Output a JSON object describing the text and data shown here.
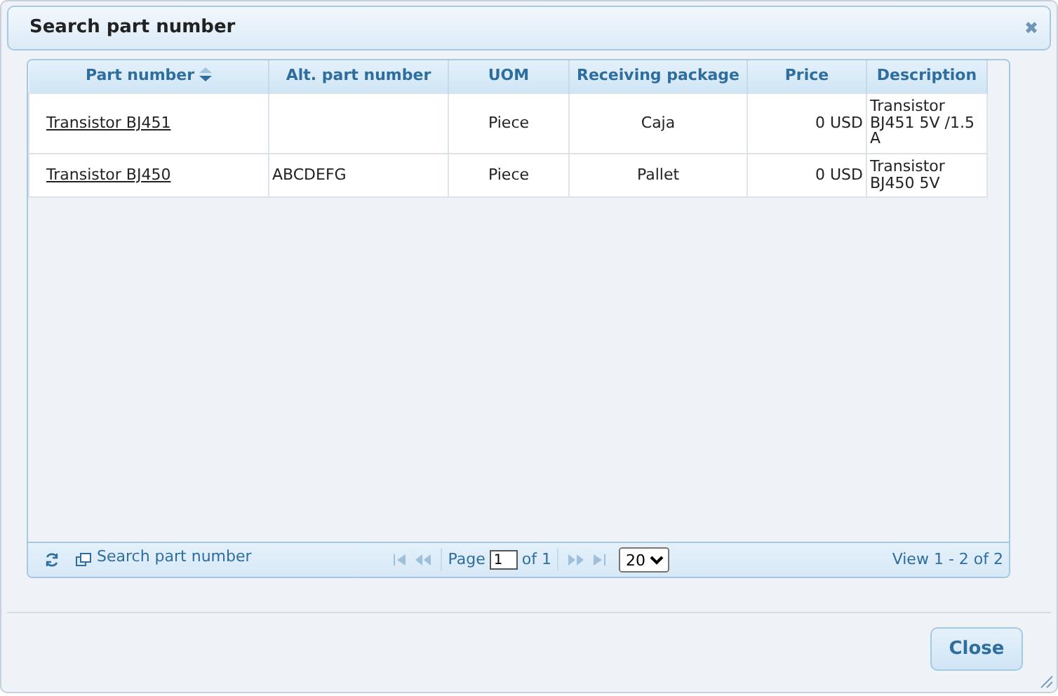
{
  "dialog": {
    "title": "Search part number",
    "close_symbol": "✖"
  },
  "table": {
    "columns": [
      {
        "label": "Part number",
        "sorted": true
      },
      {
        "label": "Alt. part number",
        "sorted": false
      },
      {
        "label": "UOM",
        "sorted": false
      },
      {
        "label": "Receiving package",
        "sorted": false
      },
      {
        "label": "Price",
        "sorted": false
      },
      {
        "label": "Description",
        "sorted": false
      }
    ],
    "rows": [
      {
        "part_number": "Transistor BJ451",
        "alt_part_number": "",
        "uom": "Piece",
        "receiving_package": "Caja",
        "price": "0 USD",
        "description": "Transistor BJ451 5V /1.5 A"
      },
      {
        "part_number": "Transistor BJ450",
        "alt_part_number": "ABCDEFG",
        "uom": "Piece",
        "receiving_package": "Pallet",
        "price": "0 USD",
        "description": "Transistor BJ450 5V"
      }
    ]
  },
  "pager": {
    "caption": "Search part number",
    "page_label": "Page",
    "page": "1",
    "of_label": "of 1",
    "page_size": "20",
    "view": "View 1 - 2 of 2",
    "first_disabled": true,
    "prev_disabled": true,
    "next_disabled": true,
    "last_disabled": true
  },
  "buttons": [
    {
      "label": "Close"
    }
  ]
}
